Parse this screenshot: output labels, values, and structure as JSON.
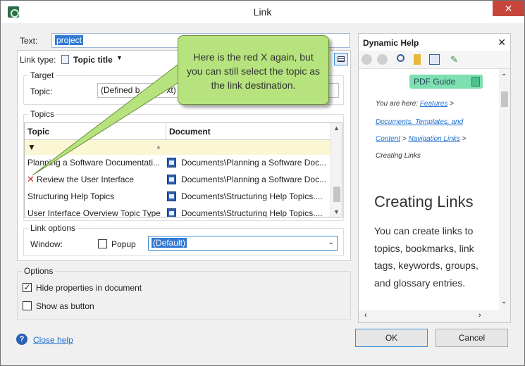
{
  "window": {
    "title": "Link",
    "close": "✕"
  },
  "text_field": {
    "label": "Text:",
    "value": "project"
  },
  "link_type": {
    "label": "Link type:",
    "value": "Topic title"
  },
  "target": {
    "group_title": "Target",
    "topic_label": "Topic:",
    "topic_value_prefix": "(Defined b",
    "topic_value_suffix": "xt)"
  },
  "topics": {
    "group_title": "Topics",
    "columns": [
      "Topic",
      "Document"
    ],
    "rows": [
      {
        "topic": "Planning a Software Documentati...",
        "document": "Documents\\Planning a Software Doc...",
        "error": false
      },
      {
        "topic": "Review the User Interface",
        "document": "Documents\\Planning a Software Doc...",
        "error": true
      },
      {
        "topic": "Structuring Help Topics",
        "document": "Documents\\Structuring Help Topics....",
        "error": false
      },
      {
        "topic": "User Interface Overview Topic Type",
        "document": "Documents\\Structuring Help Topics....",
        "error": false
      }
    ]
  },
  "link_options": {
    "group_title": "Link options",
    "window_label": "Window:",
    "popup_label": "Popup",
    "popup_checked": false,
    "window_value": "(Default)"
  },
  "options": {
    "group_title": "Options",
    "hide_properties": {
      "label": "Hide properties in document",
      "checked": true
    },
    "show_as_button": {
      "label": "Show as button",
      "checked": false
    }
  },
  "footer": {
    "close_help": "Close help",
    "ok": "OK",
    "cancel": "Cancel"
  },
  "dynamic_help": {
    "title": "Dynamic Help",
    "pdf_button": "PDF Guide",
    "breadcrumb": {
      "prefix": "You are here:",
      "link1": "Features",
      "link2": "Documents, Templates, and",
      "link3": "Content",
      "link4": "Navigation Links",
      "current": "Creating Links"
    },
    "heading": "Creating Links",
    "body": "You can create links to topics, bookmarks, link tags, keywords, groups, and glossary entries."
  },
  "callout": {
    "text": "Here is the red X again, but you can still select the topic as the link destination."
  },
  "colors": {
    "callout_fill": "#b6e37d",
    "selection": "#3279d2",
    "filter_row": "#fbf6d4",
    "error_x": "#d0281c"
  }
}
